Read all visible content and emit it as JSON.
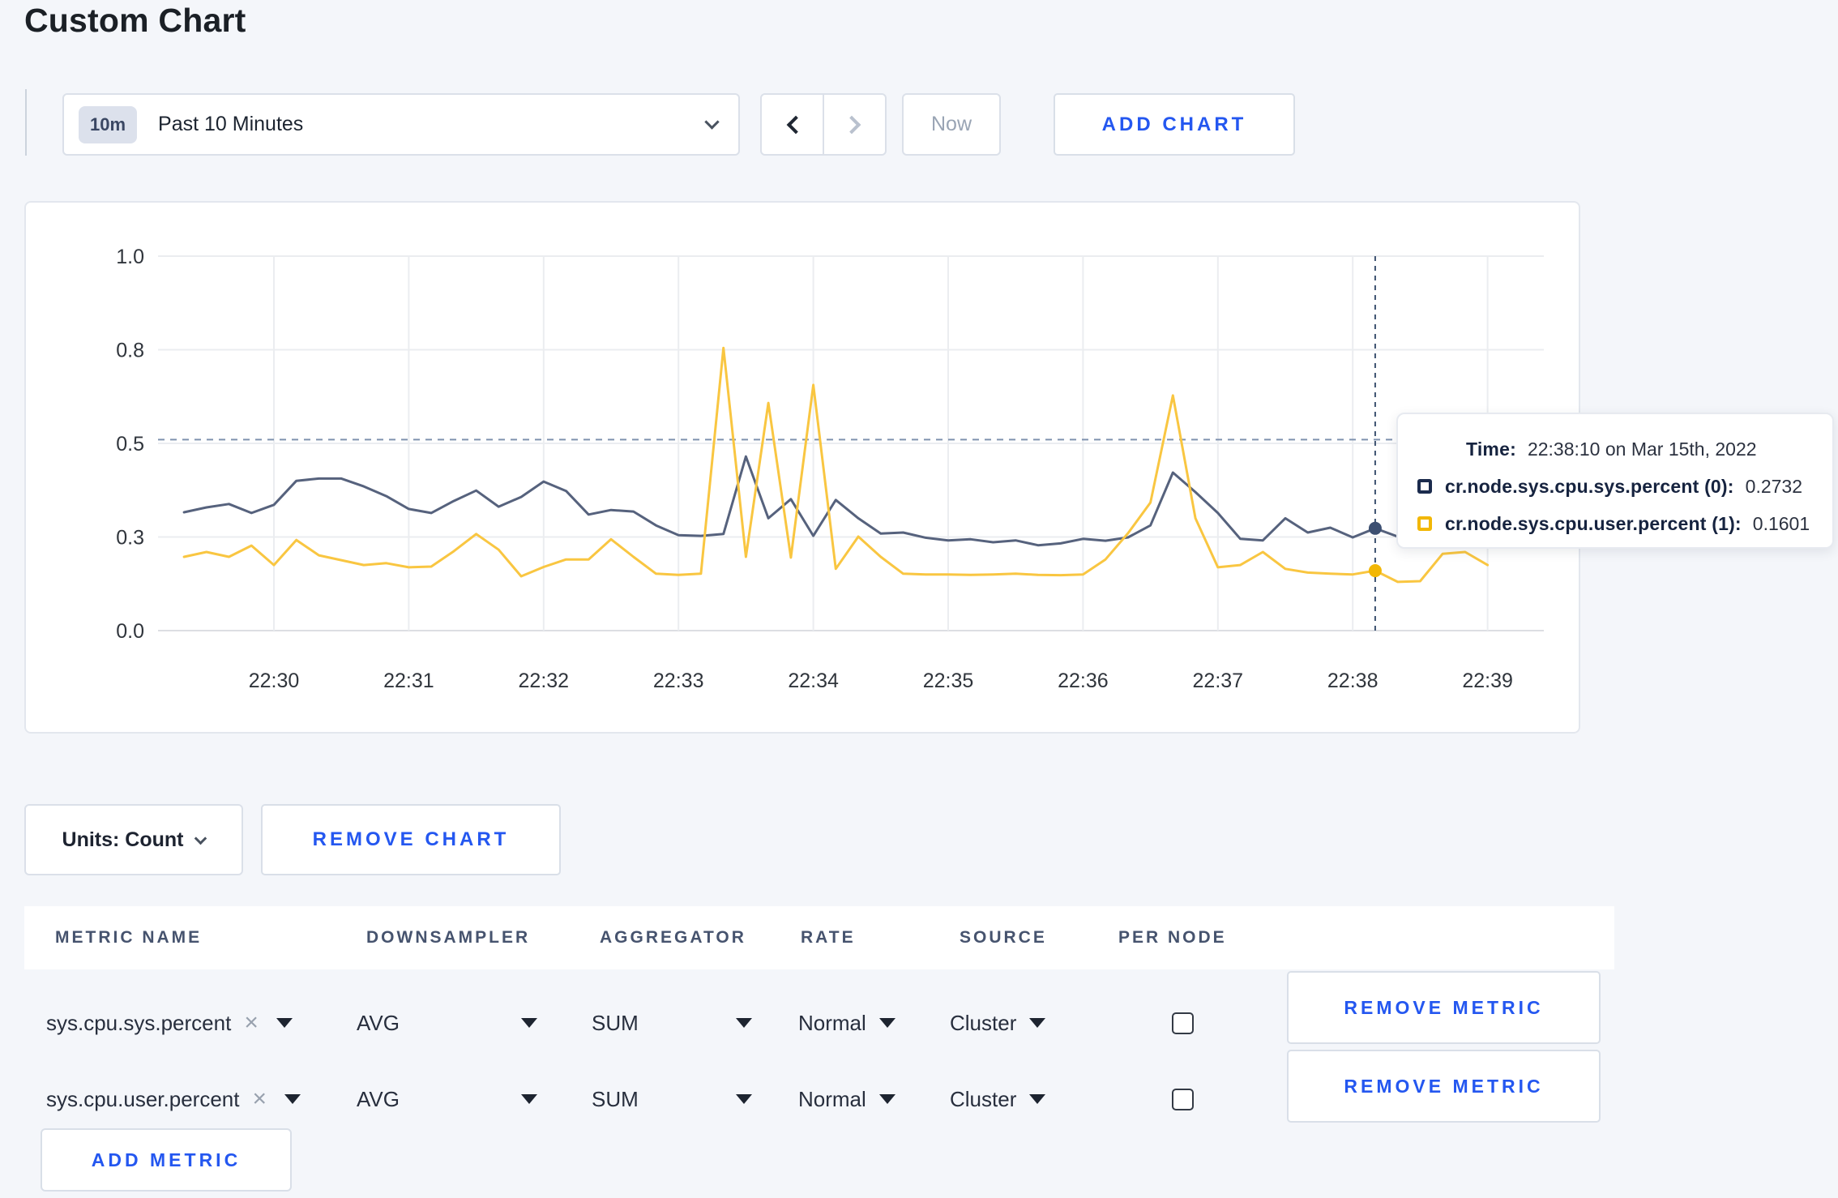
{
  "page_title": "Custom Chart",
  "toolbar": {
    "time_range_badge": "10m",
    "time_range_label": "Past 10 Minutes",
    "now_label": "Now",
    "add_chart_label": "ADD CHART"
  },
  "tooltip": {
    "time_label": "Time:",
    "time_value": "22:38:10 on Mar 15th, 2022",
    "series": [
      {
        "label": "cr.node.sys.cpu.sys.percent (0):",
        "value": "0.2732",
        "swatch_color": "#1b2b4d"
      },
      {
        "label": "cr.node.sys.cpu.user.percent (1):",
        "value": "0.1601",
        "swatch_color": "#f2b705"
      }
    ]
  },
  "units_selector": {
    "label": "Units: Count"
  },
  "remove_chart_label": "REMOVE CHART",
  "metrics_table": {
    "headers": [
      "METRIC NAME",
      "DOWNSAMPLER",
      "AGGREGATOR",
      "RATE",
      "SOURCE",
      "PER NODE"
    ],
    "rows": [
      {
        "metric_name": "sys.cpu.sys.percent",
        "downsampler": "AVG",
        "aggregator": "SUM",
        "rate": "Normal",
        "source": "Cluster",
        "per_node_checked": false,
        "remove_label": "REMOVE METRIC"
      },
      {
        "metric_name": "sys.cpu.user.percent",
        "downsampler": "AVG",
        "aggregator": "SUM",
        "rate": "Normal",
        "source": "Cluster",
        "per_node_checked": false,
        "remove_label": "REMOVE METRIC"
      }
    ],
    "add_metric_label": "ADD METRIC"
  },
  "colors": {
    "accent_blue": "#2457f0",
    "page_bg": "#f4f6fa"
  },
  "chart_data": {
    "type": "line",
    "title": "",
    "xlabel": "",
    "ylabel": "",
    "ylim": [
      0,
      1
    ],
    "grid": true,
    "legend": "none",
    "y_ticks": [
      {
        "value": 0,
        "label": "0.0"
      },
      {
        "value": 0.25,
        "label": "0.3"
      },
      {
        "value": 0.5,
        "label": "0.5"
      },
      {
        "value": 0.75,
        "label": "0.8"
      },
      {
        "value": 1.0,
        "label": "1.0"
      }
    ],
    "x_ticks": [
      "22:30",
      "22:31",
      "22:32",
      "22:33",
      "22:34",
      "22:35",
      "22:36",
      "22:37",
      "22:38",
      "22:39"
    ],
    "x": [
      "22:29:20",
      "22:29:30",
      "22:29:40",
      "22:29:50",
      "22:30:00",
      "22:30:10",
      "22:30:20",
      "22:30:30",
      "22:30:40",
      "22:30:50",
      "22:31:00",
      "22:31:10",
      "22:31:20",
      "22:31:30",
      "22:31:40",
      "22:31:50",
      "22:32:00",
      "22:32:10",
      "22:32:20",
      "22:32:30",
      "22:32:40",
      "22:32:50",
      "22:33:00",
      "22:33:10",
      "22:33:20",
      "22:33:30",
      "22:33:40",
      "22:33:50",
      "22:34:00",
      "22:34:10",
      "22:34:20",
      "22:34:30",
      "22:34:40",
      "22:34:50",
      "22:35:00",
      "22:35:10",
      "22:35:20",
      "22:35:30",
      "22:35:40",
      "22:35:50",
      "22:36:00",
      "22:36:10",
      "22:36:20",
      "22:36:30",
      "22:36:40",
      "22:36:50",
      "22:37:00",
      "22:37:10",
      "22:37:20",
      "22:37:30",
      "22:37:40",
      "22:37:50",
      "22:38:00",
      "22:38:10",
      "22:38:20",
      "22:38:30",
      "22:38:40",
      "22:38:50",
      "22:39:00"
    ],
    "series": [
      {
        "name": "cr.node.sys.cpu.sys.percent",
        "color": "#56627d",
        "dot_color": "#3c4f71",
        "values": [
          0.316,
          0.329,
          0.338,
          0.314,
          0.336,
          0.4,
          0.406,
          0.406,
          0.385,
          0.359,
          0.325,
          0.314,
          0.346,
          0.374,
          0.331,
          0.357,
          0.398,
          0.373,
          0.31,
          0.322,
          0.318,
          0.281,
          0.255,
          0.253,
          0.258,
          0.465,
          0.3,
          0.351,
          0.253,
          0.349,
          0.3,
          0.259,
          0.262,
          0.248,
          0.241,
          0.244,
          0.236,
          0.241,
          0.228,
          0.233,
          0.245,
          0.24,
          0.249,
          0.281,
          0.422,
          0.37,
          0.314,
          0.245,
          0.241,
          0.3,
          0.262,
          0.275,
          0.249,
          0.2732,
          0.251,
          0.262,
          0.255,
          0.262,
          0.27
        ]
      },
      {
        "name": "cr.node.sys.cpu.user.percent",
        "color": "#f9c641",
        "dot_color": "#f2b705",
        "values": [
          0.197,
          0.21,
          0.197,
          0.227,
          0.175,
          0.242,
          0.201,
          0.188,
          0.175,
          0.18,
          0.169,
          0.171,
          0.212,
          0.258,
          0.216,
          0.145,
          0.17,
          0.19,
          0.19,
          0.244,
          0.197,
          0.152,
          0.149,
          0.152,
          0.755,
          0.197,
          0.608,
          0.195,
          0.656,
          0.165,
          0.251,
          0.197,
          0.152,
          0.15,
          0.15,
          0.149,
          0.15,
          0.152,
          0.149,
          0.148,
          0.15,
          0.19,
          0.26,
          0.342,
          0.628,
          0.3,
          0.169,
          0.175,
          0.21,
          0.165,
          0.155,
          0.152,
          0.15,
          0.1601,
          0.13,
          0.132,
          0.205,
          0.21,
          0.175
        ]
      }
    ],
    "hover": {
      "time": "22:38:10",
      "guide_value": 0.51,
      "values": [
        0.2732,
        0.1601
      ]
    }
  }
}
